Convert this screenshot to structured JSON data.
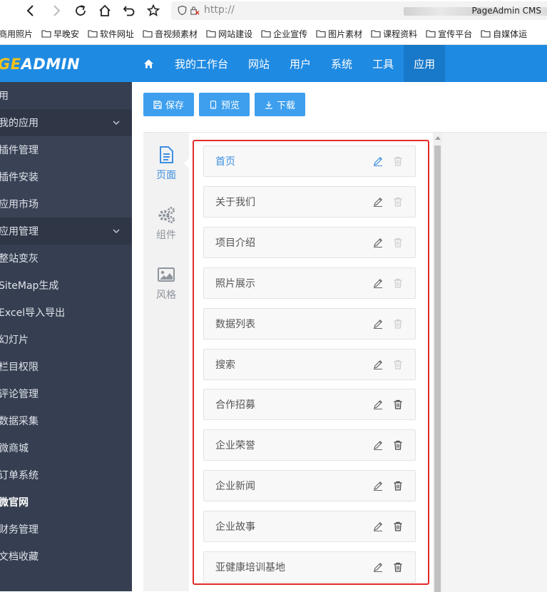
{
  "browser": {
    "url_prefix": "http://",
    "app_name": "PageAdmin CMS",
    "bookmarks": [
      "商用照片",
      "早晚安",
      "软件网址",
      "音视频素材",
      "网站建设",
      "企业宣传",
      "图片素材",
      "课程资料",
      "宣传平台",
      "自媒体运"
    ]
  },
  "header": {
    "logo_part1": "PAGE",
    "logo_part2": "ADMIN",
    "logo_visible": "GEADMIN",
    "nav": [
      "我的工作台",
      "网站",
      "用户",
      "系统",
      "工具",
      "应用"
    ],
    "active_nav": "应用"
  },
  "sidebar": {
    "items": [
      {
        "label": "用",
        "type": "header"
      },
      {
        "label": "我的应用",
        "type": "group"
      },
      {
        "label": "插件管理",
        "type": "sub"
      },
      {
        "label": "插件安装",
        "type": "sub"
      },
      {
        "label": "应用市场",
        "type": "sub"
      },
      {
        "label": "应用管理",
        "type": "group"
      },
      {
        "label": "整站变灰",
        "type": "item"
      },
      {
        "label": "SiteMap生成",
        "type": "item"
      },
      {
        "label": "Excel导入导出",
        "type": "item"
      },
      {
        "label": "幻灯片",
        "type": "item"
      },
      {
        "label": "栏目权限",
        "type": "item"
      },
      {
        "label": "评论管理",
        "type": "item"
      },
      {
        "label": "数据采集",
        "type": "item"
      },
      {
        "label": "微商城",
        "type": "item"
      },
      {
        "label": "订单系统",
        "type": "item"
      },
      {
        "label": "微官网",
        "type": "bold"
      },
      {
        "label": "财务管理",
        "type": "item"
      },
      {
        "label": "文档收藏",
        "type": "item"
      }
    ]
  },
  "toolbar": {
    "save_label": "保存",
    "preview_label": "预览",
    "download_label": "下载"
  },
  "tabs": [
    {
      "label": "页面",
      "icon": "page-icon",
      "active": true
    },
    {
      "label": "组件",
      "icon": "gears-icon",
      "active": false
    },
    {
      "label": "风格",
      "icon": "image-icon",
      "active": false
    }
  ],
  "pages": [
    {
      "name": "首页",
      "active": true,
      "deletable": false
    },
    {
      "name": "关于我们",
      "active": false,
      "deletable": false
    },
    {
      "name": "项目介绍",
      "active": false,
      "deletable": false
    },
    {
      "name": "照片展示",
      "active": false,
      "deletable": false
    },
    {
      "name": "数据列表",
      "active": false,
      "deletable": false
    },
    {
      "name": "搜索",
      "active": false,
      "deletable": false
    },
    {
      "name": "合作招募",
      "active": false,
      "deletable": true
    },
    {
      "name": "企业荣誉",
      "active": false,
      "deletable": true
    },
    {
      "name": "企业新闻",
      "active": false,
      "deletable": true
    },
    {
      "name": "企业故事",
      "active": false,
      "deletable": true
    },
    {
      "name": "亚健康培训基地",
      "active": false,
      "deletable": true
    }
  ],
  "colors": {
    "accent": "#1f8ae2",
    "highlight_border": "#e02b27",
    "sidebar_bg": "#363f51"
  }
}
